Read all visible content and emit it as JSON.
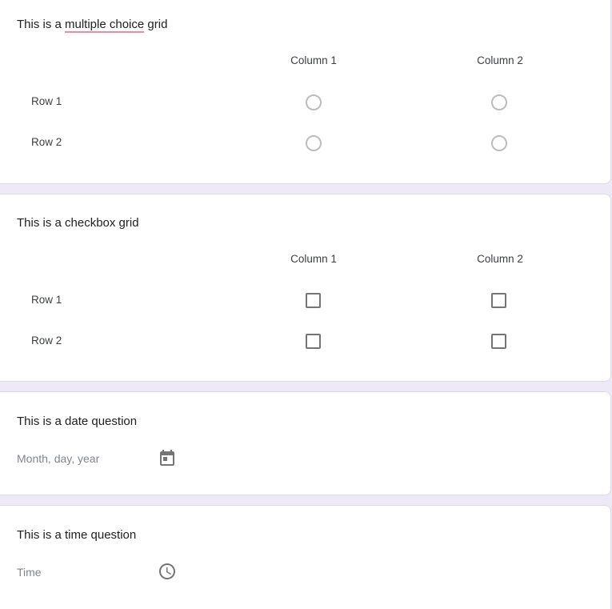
{
  "questions": {
    "mc_grid": {
      "title_before": "This is a ",
      "title_misspelled": "multiple choice",
      "title_after": " grid",
      "columns": [
        "Column 1",
        "Column 2"
      ],
      "rows": [
        "Row 1",
        "Row 2"
      ]
    },
    "checkbox_grid": {
      "title": "This is a checkbox grid",
      "columns": [
        "Column 1",
        "Column 2"
      ],
      "rows": [
        "Row 1",
        "Row 2"
      ]
    },
    "date": {
      "title": "This is a date question",
      "placeholder": "Month, day, year",
      "icon": "calendar-icon"
    },
    "time": {
      "title": "This is a time question",
      "placeholder": "Time",
      "icon": "clock-icon"
    }
  },
  "colors": {
    "page_background": "#ede9f6",
    "spellcheck_underline": "#f28b9e",
    "icon_gray": "#757575"
  }
}
